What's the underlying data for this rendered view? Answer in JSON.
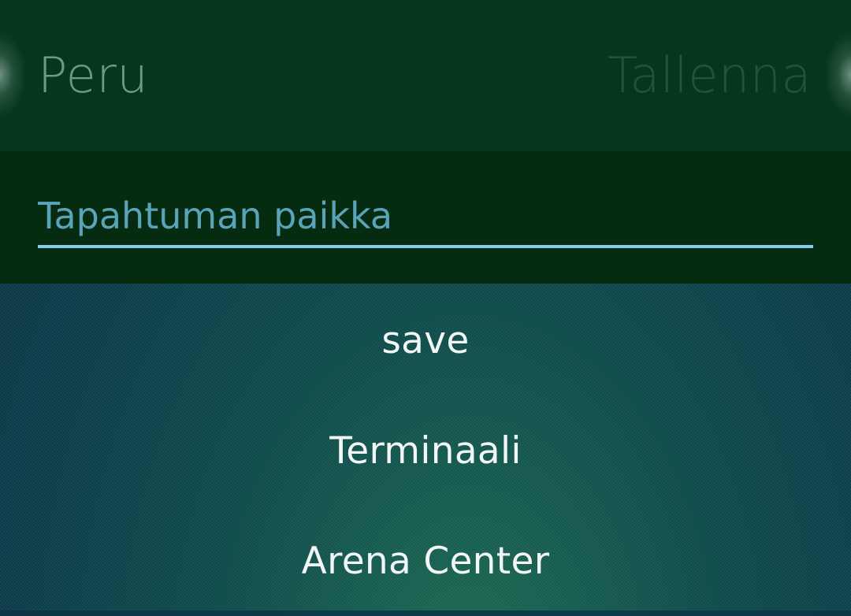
{
  "header": {
    "cancel_label": "Peru",
    "save_label": "Tallenna"
  },
  "location_field": {
    "placeholder": "Tapahtuman paikka",
    "value": ""
  },
  "suggestions": [
    {
      "label": "save"
    },
    {
      "label": "Terminaali"
    },
    {
      "label": "Arena Center"
    }
  ],
  "colors": {
    "accent_underline": "#7fd0f0",
    "placeholder_text": "#5aa3b8",
    "header_background": "#07361f",
    "field_background": "#052c10",
    "suggestion_text": "#f2f6f6"
  }
}
